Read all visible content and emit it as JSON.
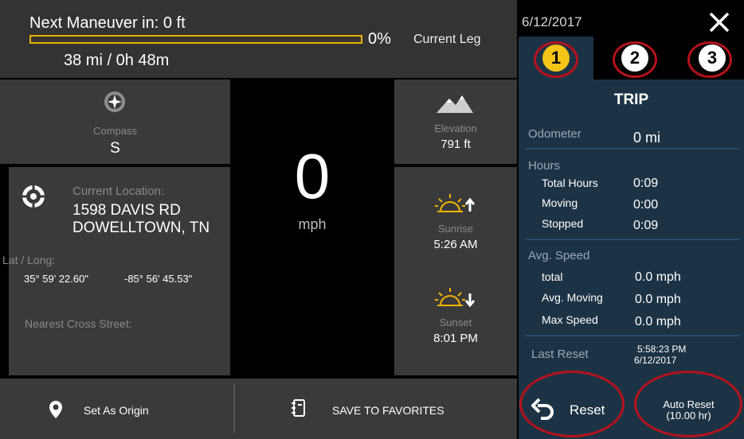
{
  "header": {
    "maneuver": "Next Maneuver in: 0 ft",
    "progress_label": "0%",
    "progress_value": 0,
    "leg_label": "Current Leg",
    "distance_time": "38 mi / 0h 48m"
  },
  "compass": {
    "icon": "compass-icon",
    "label": "Compass",
    "value": "S"
  },
  "speed": {
    "value": "0",
    "unit": "mph"
  },
  "elevation": {
    "icon": "mountain-icon",
    "label": "Elevation",
    "value": "791 ft"
  },
  "location": {
    "icon": "crosshair-icon",
    "label": "Current Location:",
    "line1": "1598 DAVIS RD",
    "line2": "DOWELLTOWN, TN",
    "latlong_label": "Lat / Long:",
    "lat": "35° 59' 22.60\"",
    "long": "-85° 56' 45.53\"",
    "cross_street_label": "Nearest Cross Street:"
  },
  "sun": {
    "sunrise_label": "Sunrise",
    "sunrise_value": "5:26 AM",
    "sunset_label": "Sunset",
    "sunset_value": "8:01 PM",
    "accent": "#f5b400"
  },
  "trip": {
    "date": "6/12/2017",
    "tabs": [
      "1",
      "2",
      "3"
    ],
    "active_tab": "1",
    "title": "TRIP",
    "odometer_label": "Odometer",
    "odometer_value": "0 mi",
    "hours_label": "Hours",
    "total_hours_label": "Total Hours",
    "total_hours_value": "0:09",
    "moving_label": "Moving",
    "moving_value": "0:00",
    "stopped_label": "Stopped",
    "stopped_value": "0:09",
    "avg_speed_label": "Avg. Speed",
    "total_label": "total",
    "total_value": "0.0 mph",
    "avg_moving_label": "Avg. Moving",
    "avg_moving_value": "0.0 mph",
    "max_speed_label": "Max Speed",
    "max_speed_value": "0.0 mph",
    "last_reset_label": "Last Reset",
    "last_reset_time": "5:58:23 PM",
    "last_reset_date": "6/12/2017"
  },
  "actions": {
    "set_origin": "Set As Origin",
    "save_favorites": "SAVE TO FAVORITES",
    "reset": "Reset",
    "auto_reset_line1": "Auto Reset",
    "auto_reset_line2": "(10.00 hr)"
  },
  "colors": {
    "progress": "#e8b400",
    "trip_panel": "#1c3346",
    "active_tab": "#f5c518",
    "highlight_ring": "#b5121b"
  }
}
